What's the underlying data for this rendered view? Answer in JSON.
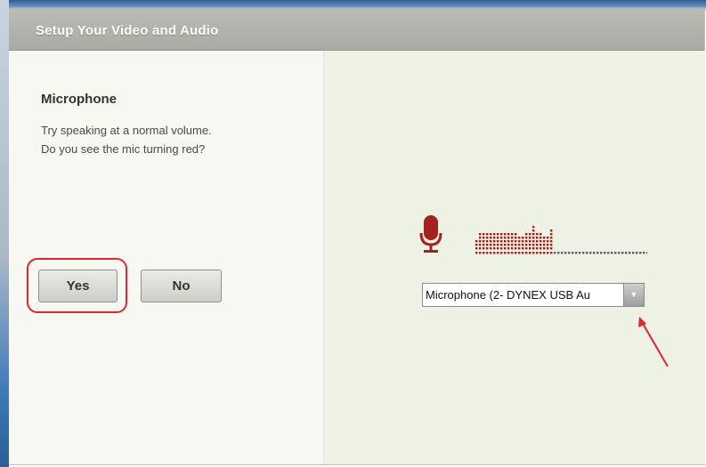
{
  "window": {
    "title": "Setup Your Video and Audio"
  },
  "microphone_panel": {
    "heading": "Microphone",
    "instruction_line1": "Try speaking at a normal volume.",
    "instruction_line2": "Do you see the mic turning red?",
    "yes_label": "Yes",
    "no_label": "No"
  },
  "device_select": {
    "value": "Microphone (2- DYNEX USB Au",
    "arrow_glyph": "▼"
  },
  "level_meter": {
    "active_bars": [
      3,
      5,
      5,
      5,
      5,
      5,
      5,
      5,
      5,
      5,
      5,
      5,
      4,
      4,
      5,
      5,
      7,
      5,
      5,
      4,
      4,
      6
    ],
    "baseline_dots": 49
  },
  "icons": {
    "microphone": "microphone-icon",
    "annotation": "arrow-annotation"
  },
  "colors": {
    "accent_red": "#a3211e",
    "meter_red": "#9b1f1a",
    "meter_gray": "#5e5e5e",
    "highlight_red": "#e3262b"
  }
}
